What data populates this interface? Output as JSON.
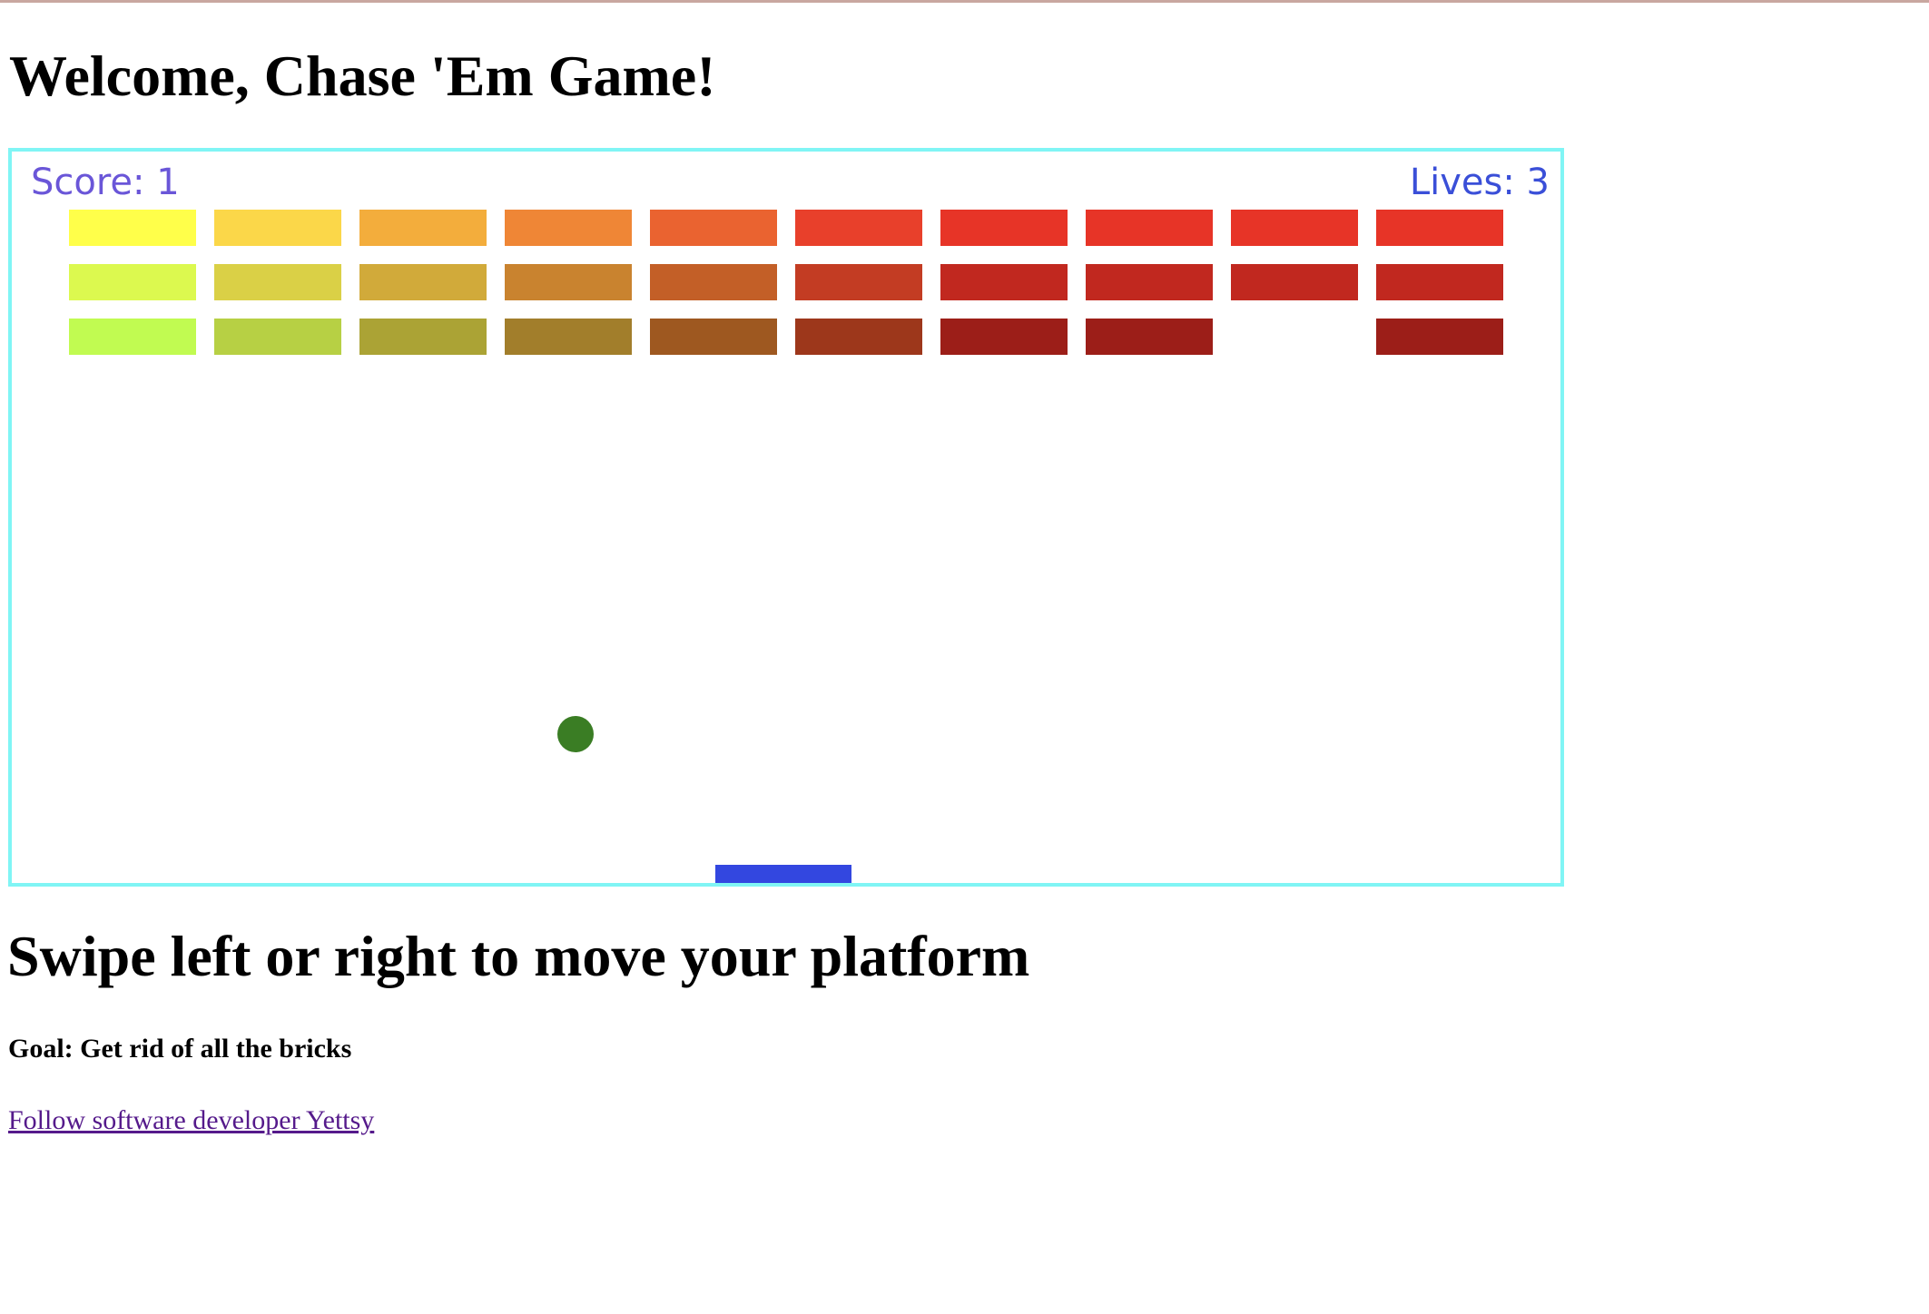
{
  "page": {
    "title": "Welcome, Chase 'Em Game!",
    "instructions": "Swipe left or right to move your platform",
    "goal": "Goal: Get rid of all the bricks",
    "follow_link": "Follow software developer Yettsy"
  },
  "game": {
    "score_text": "Score: 1",
    "lives_text": "Lives: 3",
    "score": 1,
    "lives": 3,
    "border_color": "#80f5f5",
    "ball_color": "#3a7d24",
    "paddle_color": "#3347e0",
    "bricks": [
      {
        "row": 0,
        "col": 0,
        "color": "#ffff4a",
        "present": true
      },
      {
        "row": 0,
        "col": 1,
        "color": "#fbd749",
        "present": true
      },
      {
        "row": 0,
        "col": 2,
        "color": "#f3ad3c",
        "present": true
      },
      {
        "row": 0,
        "col": 3,
        "color": "#ef8636",
        "present": true
      },
      {
        "row": 0,
        "col": 4,
        "color": "#ea6330",
        "present": true
      },
      {
        "row": 0,
        "col": 5,
        "color": "#e8402b",
        "present": true
      },
      {
        "row": 0,
        "col": 6,
        "color": "#e73427",
        "present": true
      },
      {
        "row": 0,
        "col": 7,
        "color": "#e73427",
        "present": true
      },
      {
        "row": 0,
        "col": 8,
        "color": "#e73427",
        "present": true
      },
      {
        "row": 0,
        "col": 9,
        "color": "#e73427",
        "present": true
      },
      {
        "row": 1,
        "col": 0,
        "color": "#dcf94f",
        "present": true
      },
      {
        "row": 1,
        "col": 1,
        "color": "#dad046",
        "present": true
      },
      {
        "row": 1,
        "col": 2,
        "color": "#d1aa3a",
        "present": true
      },
      {
        "row": 1,
        "col": 3,
        "color": "#c9832f",
        "present": true
      },
      {
        "row": 1,
        "col": 4,
        "color": "#c35f27",
        "present": true
      },
      {
        "row": 1,
        "col": 5,
        "color": "#c33c23",
        "present": true
      },
      {
        "row": 1,
        "col": 6,
        "color": "#c1281f",
        "present": true
      },
      {
        "row": 1,
        "col": 7,
        "color": "#c1281f",
        "present": true
      },
      {
        "row": 1,
        "col": 8,
        "color": "#c1281f",
        "present": true
      },
      {
        "row": 1,
        "col": 9,
        "color": "#c1281f",
        "present": true
      },
      {
        "row": 2,
        "col": 0,
        "color": "#c1fb51",
        "present": true
      },
      {
        "row": 2,
        "col": 1,
        "color": "#b7d044",
        "present": true
      },
      {
        "row": 2,
        "col": 2,
        "color": "#aba335",
        "present": true
      },
      {
        "row": 2,
        "col": 3,
        "color": "#a27e2b",
        "present": true
      },
      {
        "row": 2,
        "col": 4,
        "color": "#9e5820",
        "present": true
      },
      {
        "row": 2,
        "col": 5,
        "color": "#9d371b",
        "present": true
      },
      {
        "row": 2,
        "col": 6,
        "color": "#9c1e18",
        "present": true
      },
      {
        "row": 2,
        "col": 7,
        "color": "#9c1e18",
        "present": true
      },
      {
        "row": 2,
        "col": 8,
        "color": "#9c1e18",
        "present": false
      },
      {
        "row": 2,
        "col": 9,
        "color": "#9c1e18",
        "present": true
      }
    ]
  }
}
